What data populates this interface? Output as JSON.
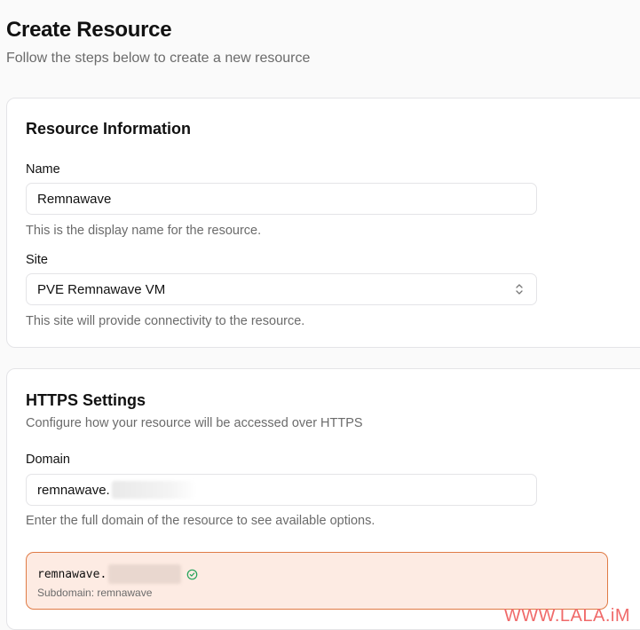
{
  "header": {
    "title": "Create Resource",
    "subtitle": "Follow the steps below to create a new resource"
  },
  "resource_info": {
    "title": "Resource Information",
    "name_label": "Name",
    "name_value": "Remnawave",
    "name_help": "This is the display name for the resource.",
    "site_label": "Site",
    "site_value": "PVE Remnawave VM",
    "site_help": "This site will provide connectivity to the resource."
  },
  "https_settings": {
    "title": "HTTPS Settings",
    "description": "Configure how your resource will be accessed over HTTPS",
    "domain_label": "Domain",
    "domain_value": "remnawave.",
    "domain_help": "Enter the full domain of the resource to see available options.",
    "suggestion_domain": "remnawave.",
    "suggestion_subdomain": "Subdomain: remnawave"
  },
  "watermark": "WWW.LALA.iM",
  "colors": {
    "accent_border": "#e07b46",
    "suggestion_bg": "#fdebe3",
    "check_green": "#22a35a"
  }
}
